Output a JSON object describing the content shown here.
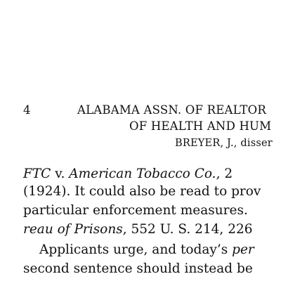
{
  "header": {
    "page_number": "4",
    "title_line1": "ALABAMA ASSN. OF REALTOR",
    "title_line2": "OF HEALTH AND HUM",
    "opinion_author_first": "B",
    "opinion_author_rest": "REYER",
    "opinion_suffix": ", J., disser"
  },
  "body": {
    "line1": {
      "case_a": "FTC",
      "sep": " v. ",
      "case_b": "American Tobacco Co.",
      "tail": ", 2"
    },
    "line2": "(1924).  It could also be read to prov",
    "line3": "particular enforcement measures.",
    "line4": {
      "case": "reau of Prisons",
      "tail": ", 552 U. S. 214, 226"
    },
    "line5": {
      "lead": "Applicants urge, and today’s ",
      "italic": "per"
    },
    "line6": "second sentence should instead be"
  }
}
